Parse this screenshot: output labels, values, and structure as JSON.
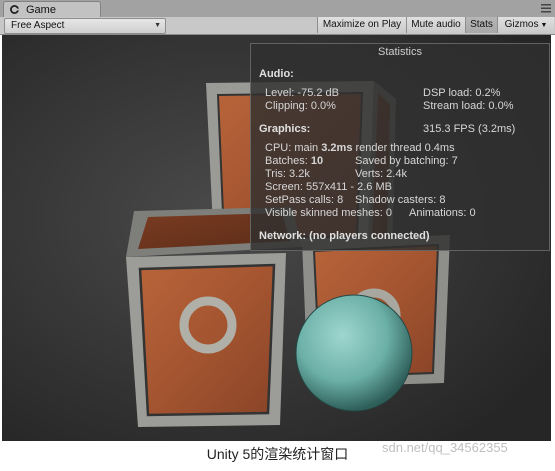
{
  "tab": {
    "title": "Game"
  },
  "toolbar": {
    "aspect": "Free Aspect",
    "maximize": "Maximize on Play",
    "mute": "Mute audio",
    "stats": "Stats",
    "gizmos": "Gizmos"
  },
  "stats": {
    "title": "Statistics",
    "audio": {
      "header": "Audio:",
      "level": "Level: -75.2 dB",
      "clipping": "Clipping: 0.0%",
      "dsp_load": "DSP load: 0.2%",
      "stream_load": "Stream load: 0.0%"
    },
    "graphics": {
      "header": "Graphics:",
      "fps": "315.3 FPS (3.2ms)",
      "cpu_prefix": "CPU: main ",
      "cpu_main": "3.2ms",
      "cpu_render": "  render thread 0.4ms",
      "batches_prefix": "Batches: ",
      "batches": "10",
      "saved_by_batching": "Saved by batching: 7",
      "tris": "Tris: 3.2k",
      "verts": "Verts: 2.4k",
      "screen": "Screen: 557x411 - 2.6 MB",
      "setpass": "SetPass calls: 8",
      "shadow_casters": "Shadow casters: 8",
      "skinned": "Visible skinned meshes: 0",
      "animations": "Animations: 0"
    },
    "network": "Network: (no players connected)"
  },
  "caption": "Unity 5的渲染统计窗口",
  "watermark": "sdn.net/qq_34562355"
}
